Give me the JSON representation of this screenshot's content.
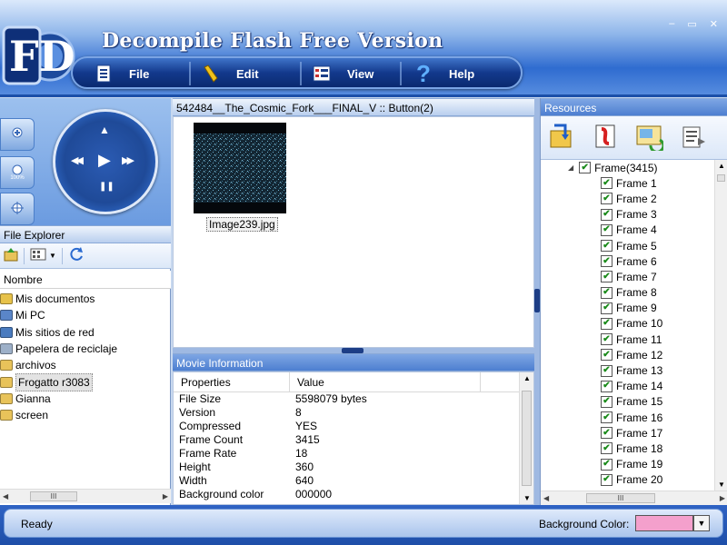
{
  "app": {
    "title": "Decompile Flash Free Version",
    "logo_text": "FD",
    "window_controls": [
      "–",
      "▭",
      "✕"
    ]
  },
  "menu": [
    {
      "label": "File",
      "icon": "file-list-icon"
    },
    {
      "label": "Edit",
      "icon": "pencil-icon"
    },
    {
      "label": "View",
      "icon": "view-grid-icon"
    },
    {
      "label": "Help",
      "icon": "question-icon"
    }
  ],
  "player": {
    "side_buttons": [
      "zoom-in-icon",
      "zoom-100-icon",
      "zoom-fit-icon"
    ],
    "side_labels": [
      "",
      "100%",
      ""
    ],
    "controls": {
      "up": "▲",
      "rewind": "◀◀",
      "play": "▶",
      "forward": "▶▶",
      "pause": "❚❚"
    }
  },
  "file_explorer": {
    "title": "File Explorer",
    "column_header": "Nombre",
    "items": [
      {
        "label": "Mis documentos",
        "icon": "my-documents-icon",
        "color": "#e7c24a"
      },
      {
        "label": "Mi PC",
        "icon": "my-computer-icon",
        "color": "#5a86c8"
      },
      {
        "label": "Mis sitios de red",
        "icon": "network-icon",
        "color": "#4a7bbf"
      },
      {
        "label": "Papelera de reciclaje",
        "icon": "recycle-bin-icon",
        "color": "#9db0c8"
      },
      {
        "label": "archivos",
        "icon": "folder-icon",
        "color": "#e8c35a"
      },
      {
        "label": "Frogatto r3083",
        "icon": "folder-icon",
        "color": "#e8c35a",
        "selected": true
      },
      {
        "label": "Gianna",
        "icon": "folder-icon",
        "color": "#e8c35a"
      },
      {
        "label": "screen",
        "icon": "folder-icon",
        "color": "#e8c35a"
      }
    ],
    "scroll_glyphs": {
      "left": "◀",
      "thumb": "III",
      "right": "▶"
    }
  },
  "center": {
    "title": "542484__The_Cosmic_Fork___FINAL_V :: Button(2)",
    "thumbnail_label": "Image239.jpg"
  },
  "movie_info": {
    "title": "Movie Information",
    "headers": {
      "property": "Properties",
      "value": "Value"
    },
    "rows": [
      {
        "property": "File Size",
        "value": "5598079 bytes"
      },
      {
        "property": "Version",
        "value": "8"
      },
      {
        "property": "Compressed",
        "value": "YES"
      },
      {
        "property": "Frame Count",
        "value": "3415"
      },
      {
        "property": "Frame Rate",
        "value": "18"
      },
      {
        "property": "Height",
        "value": "360"
      },
      {
        "property": "Width",
        "value": "640"
      },
      {
        "property": "Background color",
        "value": "000000"
      }
    ]
  },
  "resources": {
    "title": "Resources",
    "toolbar": [
      "export-folder-icon",
      "export-flash-icon",
      "refresh-image-icon",
      "export-text-icon"
    ],
    "root": {
      "label": "Frame(3415)",
      "expander": "◢"
    },
    "frames": [
      "Frame 1",
      "Frame 2",
      "Frame 3",
      "Frame 4",
      "Frame 5",
      "Frame 6",
      "Frame 7",
      "Frame 8",
      "Frame 9",
      "Frame 10",
      "Frame 11",
      "Frame 12",
      "Frame 13",
      "Frame 14",
      "Frame 15",
      "Frame 16",
      "Frame 17",
      "Frame 18",
      "Frame 19",
      "Frame 20"
    ],
    "check_glyph": "✔"
  },
  "status": {
    "text": "Ready",
    "bg_color_label": "Background Color:",
    "bg_color_value": "#f4a0cc",
    "dropdown_glyph": "▼"
  }
}
